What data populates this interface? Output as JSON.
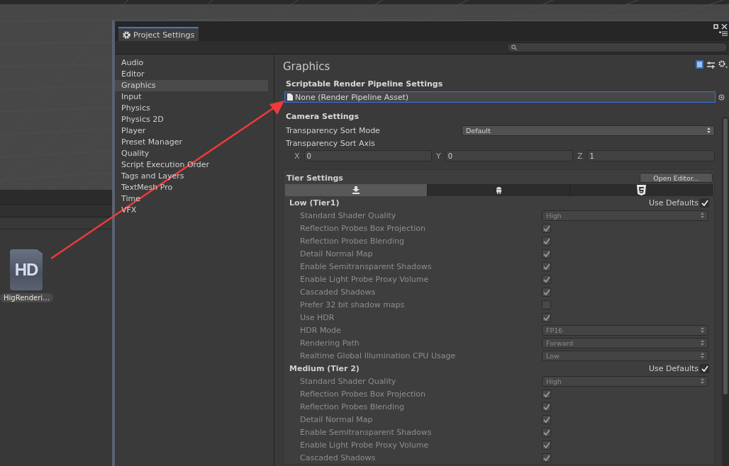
{
  "window": {
    "title": "Project Settings"
  },
  "sidebar": {
    "items": [
      {
        "label": "Audio",
        "selected": false
      },
      {
        "label": "Editor",
        "selected": false
      },
      {
        "label": "Graphics",
        "selected": true
      },
      {
        "label": "Input",
        "selected": false
      },
      {
        "label": "Physics",
        "selected": false
      },
      {
        "label": "Physics 2D",
        "selected": false
      },
      {
        "label": "Player",
        "selected": false
      },
      {
        "label": "Preset Manager",
        "selected": false
      },
      {
        "label": "Quality",
        "selected": false
      },
      {
        "label": "Script Execution Order",
        "selected": false
      },
      {
        "label": "Tags and Layers",
        "selected": false
      },
      {
        "label": "TextMesh Pro",
        "selected": false
      },
      {
        "label": "Time",
        "selected": false
      },
      {
        "label": "VFX",
        "selected": false
      }
    ]
  },
  "asset": {
    "label": "HigRenderi…",
    "badge": "HD"
  },
  "panel": {
    "title": "Graphics",
    "srp": {
      "heading": "Scriptable Render Pipeline Settings",
      "value": "None (Render Pipeline Asset)"
    },
    "camera": {
      "heading": "Camera Settings",
      "sort_mode_label": "Transparency Sort Mode",
      "sort_mode": "Default",
      "sort_axis_label": "Transparency Sort Axis",
      "axis": [
        {
          "label": "X",
          "value": "0"
        },
        {
          "label": "Y",
          "value": "0"
        },
        {
          "label": "Z",
          "value": "1"
        }
      ]
    },
    "tiers": {
      "heading": "Tier Settings",
      "button": "Open Editor...",
      "tabs": [
        {
          "kind": "download",
          "selected": true
        },
        {
          "kind": "android",
          "selected": false
        },
        {
          "kind": "html5",
          "selected": false
        }
      ],
      "groups": [
        {
          "title": "Low (Tier1)",
          "defaults_label": "Use Defaults",
          "use_defaults": true,
          "rows": [
            {
              "kind": "dropdown",
              "label": "Standard Shader Quality",
              "value": "High"
            },
            {
              "kind": "checkbox",
              "label": "Reflection Probes Box Projection",
              "checked": true
            },
            {
              "kind": "checkbox",
              "label": "Reflection Probes Blending",
              "checked": true
            },
            {
              "kind": "checkbox",
              "label": "Detail Normal Map",
              "checked": true
            },
            {
              "kind": "checkbox",
              "label": "Enable Semitransparent Shadows",
              "checked": true
            },
            {
              "kind": "checkbox",
              "label": "Enable Light Probe Proxy Volume",
              "checked": true
            },
            {
              "kind": "checkbox",
              "label": "Cascaded Shadows",
              "checked": true
            },
            {
              "kind": "checkbox",
              "label": "Prefer 32 bit shadow maps",
              "checked": false
            },
            {
              "kind": "checkbox",
              "label": "Use HDR",
              "checked": true
            },
            {
              "kind": "dropdown",
              "label": "HDR Mode",
              "value": "FP16"
            },
            {
              "kind": "dropdown",
              "label": "Rendering Path",
              "value": "Forward"
            },
            {
              "kind": "dropdown",
              "label": "Realtime Global Illumination CPU Usage",
              "value": "Low"
            }
          ]
        },
        {
          "title": "Medium (Tier 2)",
          "defaults_label": "Use Defaults",
          "use_defaults": true,
          "rows": [
            {
              "kind": "dropdown",
              "label": "Standard Shader Quality",
              "value": "High"
            },
            {
              "kind": "checkbox",
              "label": "Reflection Probes Box Projection",
              "checked": true
            },
            {
              "kind": "checkbox",
              "label": "Reflection Probes Blending",
              "checked": true
            },
            {
              "kind": "checkbox",
              "label": "Detail Normal Map",
              "checked": true
            },
            {
              "kind": "checkbox",
              "label": "Enable Semitransparent Shadows",
              "checked": true
            },
            {
              "kind": "checkbox",
              "label": "Enable Light Probe Proxy Volume",
              "checked": true
            },
            {
              "kind": "checkbox",
              "label": "Cascaded Shadows",
              "checked": true
            }
          ]
        }
      ]
    }
  }
}
